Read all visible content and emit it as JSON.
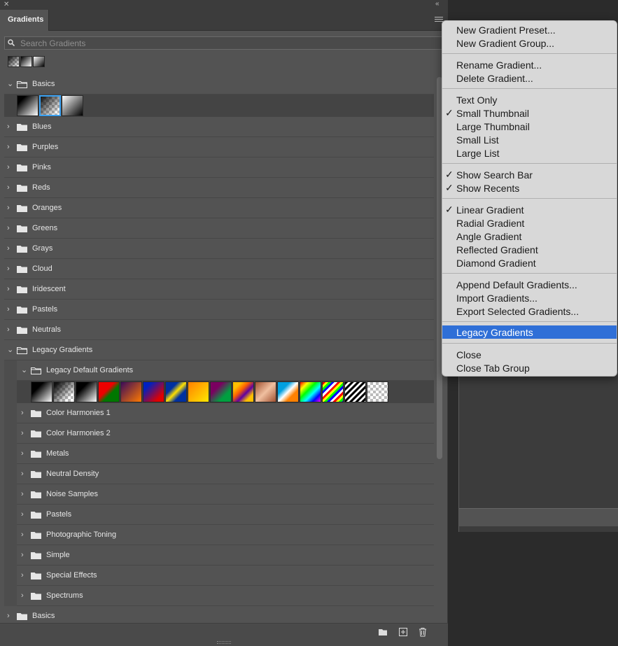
{
  "panel": {
    "tab_label": "Gradients",
    "search_placeholder": "Search Gradients"
  },
  "recents": [
    {
      "icon": "transparent-gradient"
    },
    {
      "icon": "black-white-gradient"
    },
    {
      "icon": "white-black-gradient"
    }
  ],
  "rows": [
    {
      "label": "Basics",
      "expanded": true
    },
    {
      "label": "Blues"
    },
    {
      "label": "Purples"
    },
    {
      "label": "Pinks"
    },
    {
      "label": "Reds"
    },
    {
      "label": "Oranges"
    },
    {
      "label": "Greens"
    },
    {
      "label": "Grays"
    },
    {
      "label": "Cloud"
    },
    {
      "label": "Iridescent"
    },
    {
      "label": "Pastels"
    },
    {
      "label": "Neutrals"
    },
    {
      "label": "Legacy Gradients",
      "expanded": true
    },
    {
      "label": "Legacy Default Gradients",
      "expanded": true
    },
    {
      "label": "Color Harmonies 1"
    },
    {
      "label": "Color Harmonies 2"
    },
    {
      "label": "Metals"
    },
    {
      "label": "Neutral Density"
    },
    {
      "label": "Noise Samples"
    },
    {
      "label": "Pastels"
    },
    {
      "label": "Photographic Toning"
    },
    {
      "label": "Simple"
    },
    {
      "label": "Special Effects"
    },
    {
      "label": "Spectrums"
    },
    {
      "label": "Basics"
    }
  ],
  "menu": {
    "items": [
      {
        "label": "New Gradient Preset...",
        "checked": false
      },
      {
        "label": "New Gradient Group...",
        "checked": false
      },
      {
        "label": "Rename Gradient...",
        "checked": false
      },
      {
        "label": "Delete Gradient...",
        "checked": false
      },
      {
        "label": "Text Only",
        "checked": false
      },
      {
        "label": "Small Thumbnail",
        "checked": true
      },
      {
        "label": "Large Thumbnail",
        "checked": false
      },
      {
        "label": "Small List",
        "checked": false
      },
      {
        "label": "Large List",
        "checked": false
      },
      {
        "label": "Show Search Bar",
        "checked": true
      },
      {
        "label": "Show Recents",
        "checked": true
      },
      {
        "label": "Linear Gradient",
        "checked": true
      },
      {
        "label": "Radial Gradient",
        "checked": false
      },
      {
        "label": "Angle Gradient",
        "checked": false
      },
      {
        "label": "Reflected Gradient",
        "checked": false
      },
      {
        "label": "Diamond Gradient",
        "checked": false
      },
      {
        "label": "Append Default Gradients...",
        "checked": false
      },
      {
        "label": "Import Gradients...",
        "checked": false
      },
      {
        "label": "Export Selected Gradients...",
        "checked": false
      },
      {
        "label": "Legacy Gradients",
        "checked": false,
        "highlighted": true
      },
      {
        "label": "Close",
        "checked": false
      },
      {
        "label": "Close Tab Group",
        "checked": false
      }
    ],
    "checkmark": "✓"
  },
  "colors": {
    "highlight": "#2f6fd7",
    "selection_border": "#3aa0f0"
  }
}
